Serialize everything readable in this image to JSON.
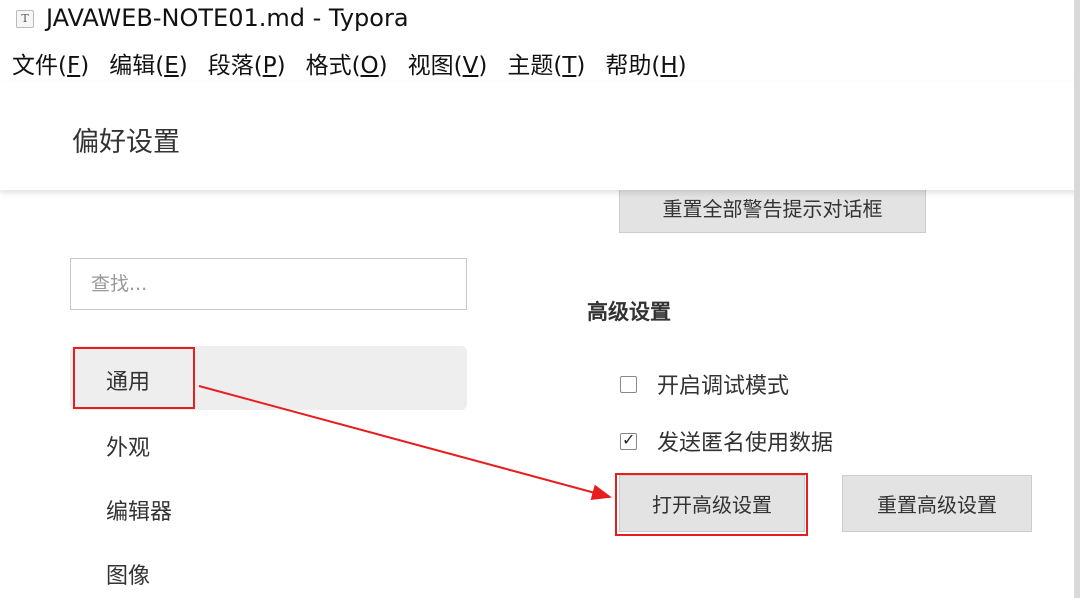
{
  "window": {
    "title": "JAVAWEB-NOTE01.md - Typora",
    "icon": "typora-doc-icon"
  },
  "menubar": [
    {
      "label": "文件(",
      "key": "F",
      "end": ")"
    },
    {
      "label": "编辑(",
      "key": "E",
      "end": ")"
    },
    {
      "label": "段落(",
      "key": "P",
      "end": ")"
    },
    {
      "label": "格式(",
      "key": "O",
      "end": ")"
    },
    {
      "label": "视图(",
      "key": "V",
      "end": ")"
    },
    {
      "label": "主题(",
      "key": "T",
      "end": ")"
    },
    {
      "label": "帮助(",
      "key": "H",
      "end": ")"
    }
  ],
  "preferences": {
    "title": "偏好设置",
    "search_placeholder": "查找...",
    "nav": [
      {
        "label": "通用",
        "active": true
      },
      {
        "label": "外观",
        "active": false
      },
      {
        "label": "编辑器",
        "active": false
      },
      {
        "label": "图像",
        "active": false
      }
    ],
    "reset_warnings_button": "重置全部警告提示对话框",
    "advanced": {
      "title": "高级设置",
      "debug_mode": {
        "label": "开启调试模式",
        "checked": false
      },
      "send_anonymous": {
        "label": "发送匿名使用数据",
        "checked": true
      },
      "open_button": "打开高级设置",
      "reset_button": "重置高级设置"
    }
  },
  "annotation": {
    "color": "#e81e1e"
  },
  "colors": {
    "edge_marks": "#2a6fb5"
  }
}
